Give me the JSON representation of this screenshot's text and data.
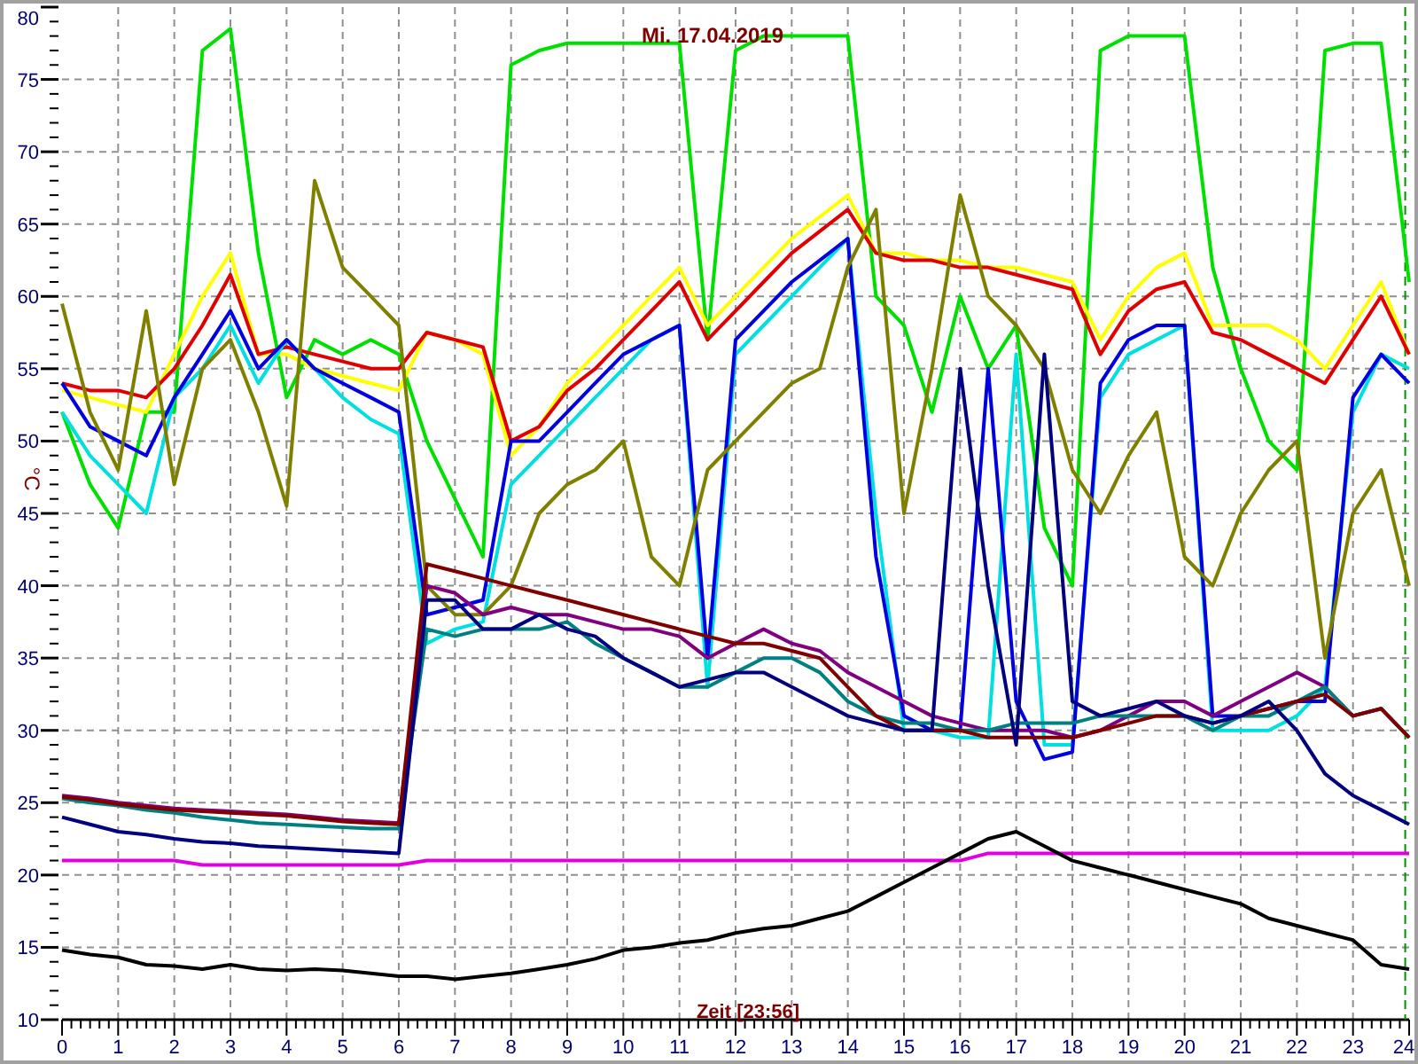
{
  "chart": {
    "chart_data": {
      "type": "line",
      "title": "Mi. 17.04.2019",
      "xlabel": "Zeit [23:56]",
      "ylabel": "°C",
      "x": [
        0,
        0.5,
        1,
        1.5,
        2,
        2.5,
        3,
        3.5,
        4,
        4.5,
        5,
        5.5,
        6,
        6.5,
        7,
        7.5,
        8,
        8.5,
        9,
        9.5,
        10,
        10.5,
        11,
        11.5,
        12,
        12.5,
        13,
        13.5,
        14,
        14.5,
        15,
        15.5,
        16,
        16.5,
        17,
        17.5,
        18,
        18.5,
        19,
        19.5,
        20,
        20.5,
        21,
        21.5,
        22,
        22.5,
        23,
        23.5,
        24
      ],
      "xlim": [
        0,
        24
      ],
      "ylim": [
        10,
        80
      ],
      "grid": true,
      "xticks": [
        0,
        1,
        2,
        3,
        4,
        5,
        6,
        7,
        8,
        9,
        10,
        11,
        12,
        13,
        14,
        15,
        16,
        17,
        18,
        19,
        20,
        21,
        22,
        23,
        24
      ],
      "yticks": [
        10,
        15,
        20,
        25,
        30,
        35,
        40,
        45,
        50,
        55,
        60,
        65,
        70,
        75,
        80
      ],
      "series": [
        {
          "color": "#00e000",
          "values": [
            52,
            47,
            44,
            52,
            52,
            77,
            78.5,
            63,
            53,
            57,
            56,
            57,
            56,
            50,
            46,
            42,
            76,
            77,
            77.5,
            77.5,
            77.5,
            77.5,
            77.5,
            57,
            77,
            78,
            78,
            78,
            78,
            60,
            58,
            52,
            60,
            55,
            58,
            44,
            40,
            77,
            78,
            78,
            78,
            62,
            55,
            50,
            48,
            77,
            77.5,
            77.5,
            61
          ]
        },
        {
          "color": "#ffff00",
          "values": [
            53.5,
            53,
            52.5,
            52,
            56,
            60,
            63,
            56,
            56,
            55,
            54.5,
            54,
            53.5,
            57.5,
            57,
            56,
            49,
            51,
            54,
            56,
            58,
            60,
            62,
            58,
            60,
            62,
            64,
            65.5,
            67,
            63,
            63,
            62.5,
            62.5,
            62,
            62,
            61.5,
            61,
            57,
            60,
            62,
            63,
            58,
            58,
            58,
            57,
            55,
            58,
            61,
            56
          ]
        },
        {
          "color": "#e00000",
          "values": [
            54,
            53.5,
            53.5,
            53,
            55,
            58,
            61.5,
            56,
            56.5,
            56,
            55.5,
            55,
            55,
            57.5,
            57,
            56.5,
            50,
            51,
            53.5,
            55,
            57,
            59,
            61,
            57,
            59,
            61,
            63,
            64.5,
            66,
            63,
            62.5,
            62.5,
            62,
            62,
            61.5,
            61,
            60.5,
            56,
            59,
            60.5,
            61,
            57.5,
            57,
            56,
            55,
            54,
            57,
            60,
            56
          ]
        },
        {
          "color": "#00e0e0",
          "values": [
            52,
            49,
            47,
            45,
            53,
            55,
            58,
            54,
            57,
            55,
            53,
            51.5,
            50.5,
            36,
            37,
            37.5,
            47,
            49,
            51,
            53,
            55,
            57,
            58,
            33,
            56,
            58,
            60,
            62,
            64,
            45,
            30,
            30,
            29.5,
            29.5,
            56,
            29,
            29,
            53,
            56,
            57,
            58,
            30,
            30,
            30,
            31,
            33,
            52,
            56,
            55
          ]
        },
        {
          "color": "#0000e0",
          "values": [
            54,
            51,
            50,
            49,
            53,
            56,
            59,
            55,
            57,
            55,
            54,
            53,
            52,
            38,
            38.5,
            39,
            50,
            50,
            52,
            54,
            56,
            57,
            58,
            35,
            57,
            59,
            61,
            62.5,
            64,
            42,
            31,
            30,
            30,
            55,
            32,
            28,
            28.5,
            54,
            57,
            58,
            58,
            31,
            31,
            31.5,
            32,
            32,
            53,
            56,
            54
          ]
        },
        {
          "color": "#808000",
          "values": [
            59.5,
            52,
            48,
            59,
            47,
            55,
            57,
            52,
            45.5,
            68,
            62,
            60,
            58,
            40,
            38,
            38,
            40,
            45,
            47,
            48,
            50,
            42,
            40,
            48,
            50,
            52,
            54,
            55,
            62,
            66,
            45,
            55,
            67,
            60,
            58,
            55,
            48,
            45,
            49,
            52,
            42,
            40,
            45,
            48,
            50,
            35,
            45,
            48,
            40
          ]
        },
        {
          "color": "#800080",
          "values": [
            25.5,
            25.3,
            25,
            24.8,
            24.6,
            24.5,
            24.4,
            24.3,
            24.2,
            24,
            23.8,
            23.7,
            23.6,
            40,
            39.5,
            38,
            38.5,
            38,
            38,
            37.5,
            37,
            37,
            36.5,
            35,
            36,
            37,
            36,
            35.5,
            34,
            33,
            32,
            31,
            30.5,
            30,
            30,
            30,
            29.5,
            30,
            31,
            32,
            32,
            31,
            32,
            33,
            34,
            33,
            31,
            31.5,
            29.5
          ]
        },
        {
          "color": "#008080",
          "values": [
            25.3,
            25,
            24.8,
            24.5,
            24.3,
            24,
            23.8,
            23.6,
            23.5,
            23.4,
            23.3,
            23.2,
            23.2,
            37,
            36.5,
            37,
            37,
            37,
            37.5,
            36,
            35,
            34,
            33,
            33,
            34,
            35,
            35,
            34,
            32,
            31,
            30.5,
            30.5,
            30,
            30,
            30.5,
            30.5,
            30.5,
            31,
            31,
            31,
            31,
            30,
            31,
            31,
            32,
            33,
            31,
            31.5,
            29.5
          ]
        },
        {
          "color": "#800000",
          "values": [
            25.4,
            25.2,
            24.9,
            24.7,
            24.5,
            24.4,
            24.3,
            24.2,
            24.1,
            23.9,
            23.7,
            23.6,
            23.5,
            41.5,
            41,
            40.5,
            40,
            39.5,
            39,
            38.5,
            38,
            37.5,
            37,
            36.5,
            36,
            36,
            35.5,
            35,
            33,
            31,
            30,
            30,
            30,
            29.5,
            29.5,
            29.5,
            29.5,
            30,
            30.5,
            31,
            31,
            30.5,
            31,
            31.5,
            32,
            32.5,
            31,
            31.5,
            29.5
          ]
        },
        {
          "color": "#000080",
          "values": [
            24,
            23.5,
            23,
            22.8,
            22.5,
            22.3,
            22.2,
            22,
            21.9,
            21.8,
            21.7,
            21.6,
            21.5,
            39,
            39,
            37,
            37,
            38,
            37,
            36.5,
            35,
            34,
            33,
            33.5,
            34,
            34,
            33,
            32,
            31,
            30.5,
            30,
            30,
            55,
            40,
            29,
            56,
            32,
            31,
            31.5,
            32,
            31,
            30.5,
            31,
            32,
            30,
            27,
            25.5,
            24.5,
            23.5
          ]
        },
        {
          "color": "#e000e0",
          "values": [
            21,
            21,
            21,
            21,
            21,
            20.7,
            20.7,
            20.7,
            20.7,
            20.7,
            20.7,
            20.7,
            20.7,
            21,
            21,
            21,
            21,
            21,
            21,
            21,
            21,
            21,
            21,
            21,
            21,
            21,
            21,
            21,
            21,
            21,
            21,
            21,
            21,
            21.5,
            21.5,
            21.5,
            21.5,
            21.5,
            21.5,
            21.5,
            21.5,
            21.5,
            21.5,
            21.5,
            21.5,
            21.5,
            21.5,
            21.5,
            21.5
          ]
        },
        {
          "color": "#000000",
          "values": [
            14.8,
            14.5,
            14.3,
            13.8,
            13.7,
            13.5,
            13.8,
            13.5,
            13.4,
            13.5,
            13.4,
            13.2,
            13,
            13,
            12.8,
            13,
            13.2,
            13.5,
            13.8,
            14.2,
            14.8,
            15,
            15.3,
            15.5,
            16,
            16.3,
            16.5,
            17,
            17.5,
            18.5,
            19.5,
            20.5,
            21.5,
            22.5,
            23,
            22,
            21,
            20.5,
            20,
            19.5,
            19,
            18.5,
            18,
            17,
            16.5,
            16,
            15.5,
            13.8,
            13.5
          ]
        }
      ]
    }
  }
}
